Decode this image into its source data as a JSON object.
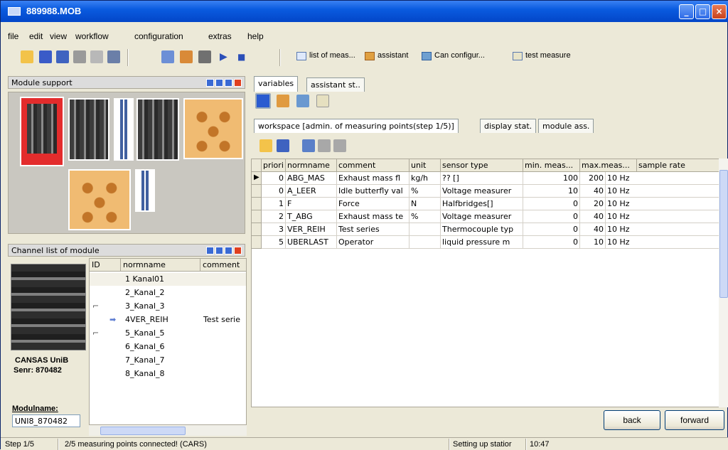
{
  "window": {
    "title": "889988.MOB"
  },
  "menu": [
    "file",
    "edit",
    "view",
    "workflow",
    "configuration",
    "extras",
    "help"
  ],
  "toolbar": {
    "list_meas": "list of meas...",
    "assistant": "assistant",
    "can_config": "Can configur...",
    "test_measure": "test measure"
  },
  "module_support": {
    "title": "Module support"
  },
  "channel_list": {
    "title": "Channel list of module",
    "columns": [
      "ID",
      "normname",
      "comment"
    ],
    "rows": [
      {
        "id": "",
        "normname": "1 Kanal01",
        "comment": ""
      },
      {
        "id": "",
        "normname": "2_Kanal_2",
        "comment": ""
      },
      {
        "id": "",
        "normname": "3_Kanal_3",
        "comment": ""
      },
      {
        "id": "",
        "normname": "4VER_REIH",
        "comment": "Test serie"
      },
      {
        "id": "",
        "normname": "5_Kanal_5",
        "comment": ""
      },
      {
        "id": "",
        "normname": "6_Kanal_6",
        "comment": ""
      },
      {
        "id": "",
        "normname": "7_Kanal_7",
        "comment": ""
      },
      {
        "id": "",
        "normname": "8_Kanal_8",
        "comment": ""
      }
    ]
  },
  "module_info": {
    "line1": "CANSAS UniB",
    "line2": "Senr: 870482",
    "modulname_label": "Modulname:",
    "modulname_value": "UNI8_870482"
  },
  "tabs": [
    "variables",
    "assistant st.."
  ],
  "sub_tabs": [
    "workspace [admin. of measuring points(step 1/5)]",
    "display stat.",
    "module ass."
  ],
  "grid": {
    "columns": [
      "priori",
      "normname",
      "comment",
      "unit",
      "sensor type",
      "min. meas...",
      "max.meas...",
      "sample rate"
    ],
    "rows": [
      {
        "prio": "0",
        "normname": "ABG_MAS",
        "comment": "Exhaust mass fl",
        "unit": "kg/h",
        "sensor": "?? []",
        "min": "100",
        "max": "200",
        "rate": "10 Hz"
      },
      {
        "prio": "0",
        "normname": "A_LEER",
        "comment": "Idle butterfly val",
        "unit": "%",
        "sensor": "Voltage measurer",
        "min": "10",
        "max": "40",
        "rate": "10 Hz"
      },
      {
        "prio": "1",
        "normname": "F",
        "comment": "Force",
        "unit": "N",
        "sensor": "Halfbridges[]",
        "min": "0",
        "max": "20",
        "rate": "10 Hz"
      },
      {
        "prio": "2",
        "normname": "T_ABG",
        "comment": "Exhaust mass te",
        "unit": "%",
        "sensor": "Voltage measurer",
        "min": "0",
        "max": "40",
        "rate": "10 Hz"
      },
      {
        "prio": "3",
        "normname": "VER_REIH",
        "comment": "Test series",
        "unit": "",
        "sensor": "Thermocouple typ",
        "min": "0",
        "max": "40",
        "rate": "10 Hz"
      },
      {
        "prio": "5",
        "normname": "UBERLAST",
        "comment": "Operator",
        "unit": "",
        "sensor": "liquid pressure m",
        "min": "0",
        "max": "10",
        "rate": "10 Hz"
      }
    ]
  },
  "buttons": {
    "back": "back",
    "forward": "forward"
  },
  "status": {
    "step": "Step 1/5",
    "message": "2/5 measuring points connected! (CARS)",
    "station": "Setting up statior",
    "time": "10:47"
  }
}
